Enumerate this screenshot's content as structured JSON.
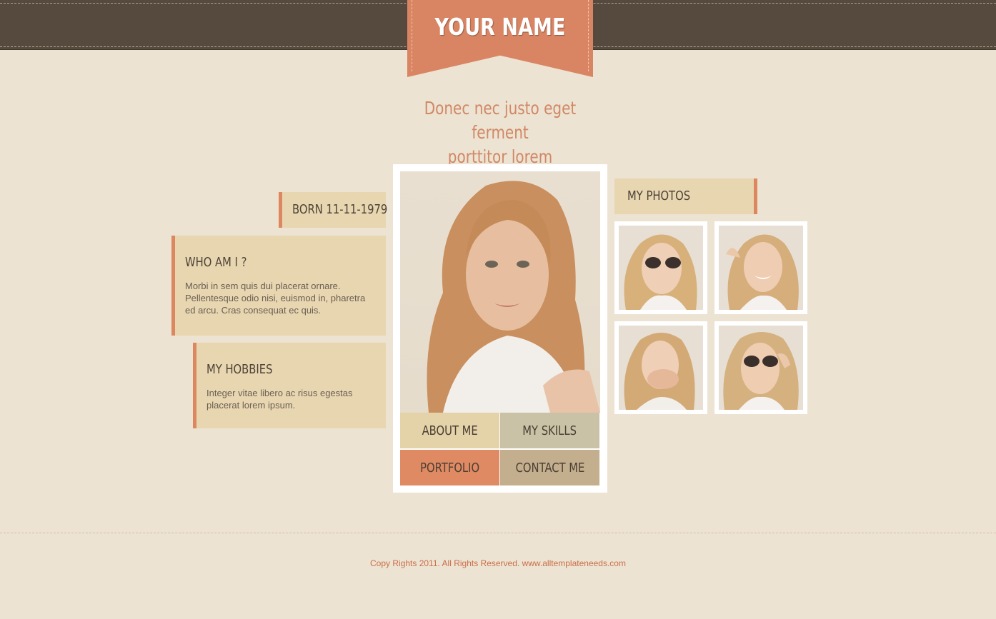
{
  "header": {
    "name": "YOUR NAME",
    "tagline_line1": "Donec nec justo eget ferment",
    "tagline_line2": "porttitor lorem"
  },
  "info": {
    "born": "BORN 11-11-1979",
    "who_title": "WHO AM I ?",
    "who_text": "Morbi in sem quis dui placerat ornare. Pellentesque odio nisi, euismod in, pharetra ed arcu. Cras consequat ec quis.",
    "hobbies_title": "MY HOBBIES",
    "hobbies_text": "Integer vitae libero ac risus egestas placerat lorem ipsum."
  },
  "nav": {
    "about": "ABOUT ME",
    "skills": "MY SKILLS",
    "portfolio": "PORTFOLIO",
    "contact": "CONTACT ME"
  },
  "photos": {
    "title": "MY PHOTOS"
  },
  "footer": {
    "text": "Copy Rights 2011. All Rights Reserved. www.alltemplateneeds.com"
  },
  "colors": {
    "accent": "#dd8760",
    "topbar": "#564a3e",
    "background": "#ede3d2",
    "panel": "#e8d6b0"
  }
}
